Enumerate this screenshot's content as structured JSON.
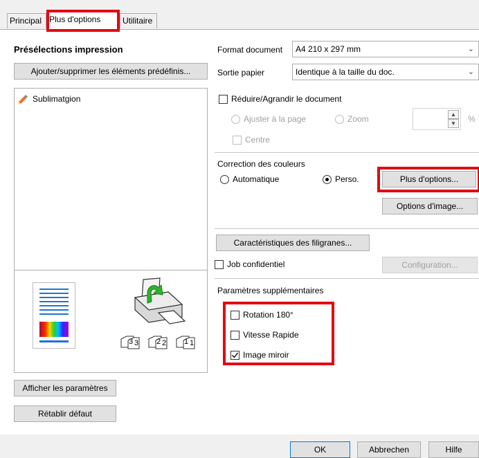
{
  "tabs": [
    {
      "label": "Principal"
    },
    {
      "label": "Plus d'options"
    },
    {
      "label": "Utilitaire"
    }
  ],
  "presets": {
    "title": "Présélections impression",
    "add_remove_button": "Ajouter/supprimer les éléments prédéfinis...",
    "items": [
      {
        "label": "Sublimatgion",
        "icon": "pencil-icon"
      }
    ]
  },
  "preview": {
    "icon_names": [
      "document-preview-icon",
      "printer-icon",
      "collate-icon"
    ],
    "collate_pages": [
      "3",
      "2",
      "1"
    ]
  },
  "left_buttons": {
    "show_settings": "Afficher les paramètres",
    "restore_defaults": "Rétablir défaut"
  },
  "format": {
    "label": "Format document",
    "value": "A4 210 x 297 mm"
  },
  "output": {
    "label": "Sortie papier",
    "value": "Identique à la taille du doc."
  },
  "reduce": {
    "label": "Réduire/Agrandir le document",
    "fit_page": "Ajuster à la page",
    "zoom": "Zoom",
    "center": "Centre",
    "percent_unit": "%"
  },
  "color": {
    "title": "Correction des couleurs",
    "auto": "Automatique",
    "custom": "Perso.",
    "more_options_button": "Plus d'options...",
    "image_options_button": "Options d'image..."
  },
  "watermark_button": "Caractéristiques des filigranes...",
  "confidential": {
    "label": "Job confidentiel",
    "config_button": "Configuration..."
  },
  "extra": {
    "title": "Paramètres supplémentaires",
    "rotation": "Rotation 180°",
    "speed": "Vitesse Rapide",
    "mirror": "Image miroir",
    "mirror_checked": true
  },
  "footer": {
    "ok": "OK",
    "cancel": "Abbrechen",
    "help": "Hilfe"
  },
  "colors": {
    "highlight_red": "#e30613",
    "doc_lines_blue": "#1e73d2",
    "printer_arrow_green": "#2ab52a"
  }
}
